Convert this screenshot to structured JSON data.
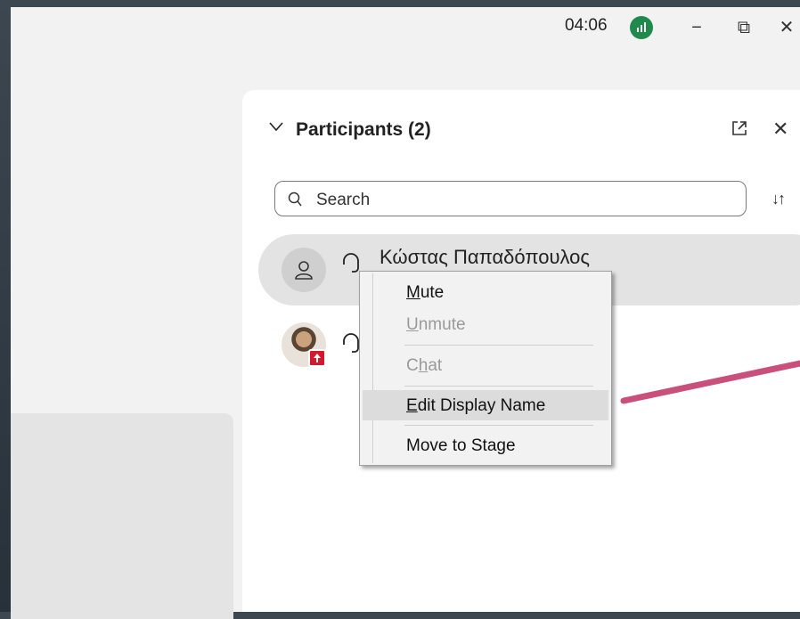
{
  "titlebar": {
    "time": "04:06",
    "minimize_glyph": "−",
    "maximize_glyph": "⧉",
    "close_glyph": "✕"
  },
  "panel": {
    "title": "Participants (2)",
    "close_glyph": "✕",
    "sort_glyph": "↓↑"
  },
  "search": {
    "placeholder": "Search"
  },
  "participants": [
    {
      "name": "Κώστας Παπαδόπουλος",
      "avatar": "person-icon"
    },
    {
      "name": "",
      "avatar": "photo",
      "badge": "share-up-icon"
    }
  ],
  "context_menu": {
    "items": [
      {
        "label": "Mute",
        "accel": "M",
        "rest": "ute",
        "enabled": true
      },
      {
        "label": "Unmute",
        "accel": "U",
        "rest": "nmute",
        "enabled": false
      },
      {
        "label": "Chat",
        "pre": "C",
        "accel": "h",
        "rest": "at",
        "enabled": false
      },
      {
        "label": "Edit Display Name",
        "accel": "E",
        "rest": "dit Display Name",
        "enabled": true,
        "highlighted": true
      },
      {
        "label": "Move to Stage",
        "pre": "Move to Sta",
        "accel": "g",
        "rest": "e",
        "enabled": true
      }
    ]
  },
  "colors": {
    "signal": "#1f8a4c",
    "annotation_line": "#c8507a",
    "badge": "#d21a2f"
  }
}
